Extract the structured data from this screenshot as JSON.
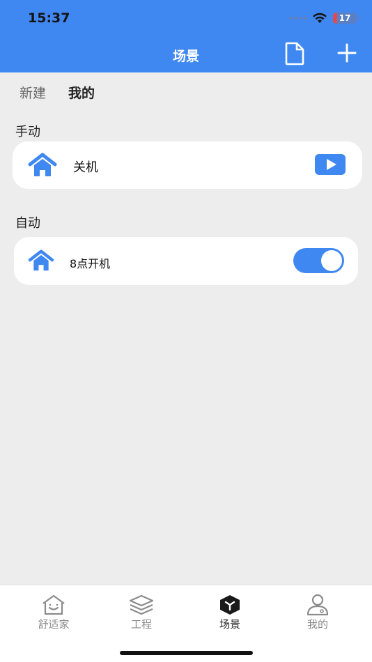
{
  "status": {
    "time": "15:37",
    "battery": "17"
  },
  "nav": {
    "title": "场景"
  },
  "tabs": [
    {
      "label": "新建",
      "active": false
    },
    {
      "label": "我的",
      "active": true
    }
  ],
  "sections": {
    "manual": {
      "label": "手动",
      "scene": "关机"
    },
    "auto": {
      "label": "自动",
      "scene": "8点开机",
      "enabled": true
    }
  },
  "tabbar": [
    {
      "label": "舒适家",
      "icon": "home-smile-icon",
      "active": false
    },
    {
      "label": "工程",
      "icon": "layers-icon",
      "active": false
    },
    {
      "label": "场景",
      "icon": "scene-cube-icon",
      "active": true
    },
    {
      "label": "我的",
      "icon": "user-icon",
      "active": false
    }
  ],
  "colors": {
    "accent": "#4088f1",
    "background": "#ededed"
  }
}
